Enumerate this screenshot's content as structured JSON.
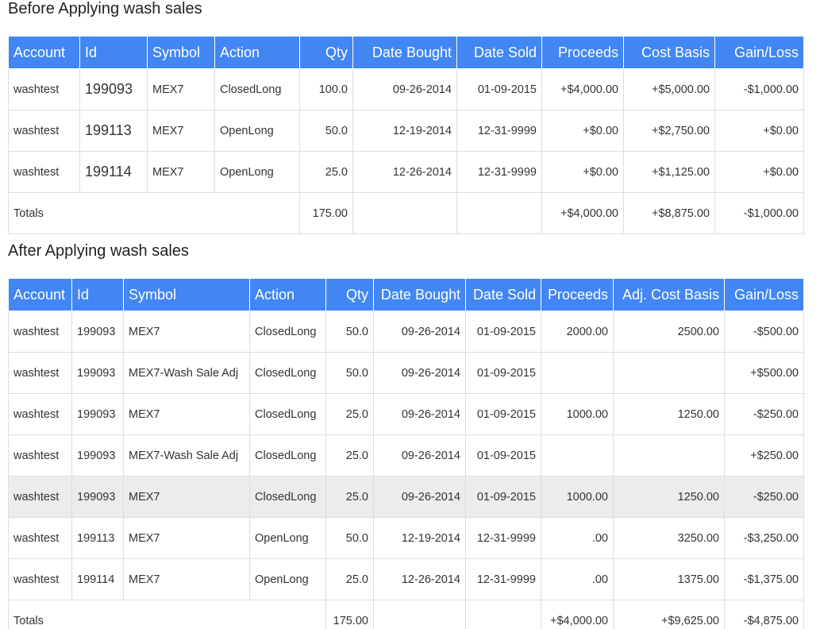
{
  "before": {
    "title": "Before Applying wash sales",
    "headers": {
      "account": "Account",
      "id": "Id",
      "symbol": "Symbol",
      "action": "Action",
      "qty": "Qty",
      "date_bought": "Date Bought",
      "date_sold": "Date Sold",
      "proceeds": "Proceeds",
      "cost_basis": "Cost Basis",
      "gain_loss": "Gain/Loss"
    },
    "rows": [
      {
        "account": "washtest",
        "id": "199093",
        "symbol": "MEX7",
        "action": "ClosedLong",
        "qty": "100.0",
        "date_bought": "09-26-2014",
        "date_sold": "01-09-2015",
        "proceeds": "+$4,000.00",
        "cost_basis": "+$5,000.00",
        "gain_loss": "-$1,000.00"
      },
      {
        "account": "washtest",
        "id": "199113",
        "symbol": "MEX7",
        "action": "OpenLong",
        "qty": "50.0",
        "date_bought": "12-19-2014",
        "date_sold": "12-31-9999",
        "proceeds": "+$0.00",
        "cost_basis": "+$2,750.00",
        "gain_loss": "+$0.00"
      },
      {
        "account": "washtest",
        "id": "199114",
        "symbol": "MEX7",
        "action": "OpenLong",
        "qty": "25.0",
        "date_bought": "12-26-2014",
        "date_sold": "12-31-9999",
        "proceeds": "+$0.00",
        "cost_basis": "+$1,125.00",
        "gain_loss": "+$0.00"
      }
    ],
    "totals": {
      "label": "Totals",
      "qty": "175.00",
      "proceeds": "+$4,000.00",
      "cost_basis": "+$8,875.00",
      "gain_loss": "-$1,000.00"
    }
  },
  "after": {
    "title": "After Applying wash sales",
    "headers": {
      "account": "Account",
      "id": "Id",
      "symbol": "Symbol",
      "action": "Action",
      "qty": "Qty",
      "date_bought": "Date Bought",
      "date_sold": "Date Sold",
      "proceeds": "Proceeds",
      "cost_basis": "Adj. Cost Basis",
      "gain_loss": "Gain/Loss"
    },
    "rows": [
      {
        "account": "washtest",
        "id": "199093",
        "symbol": "MEX7",
        "action": "ClosedLong",
        "qty": "50.0",
        "date_bought": "09-26-2014",
        "date_sold": "01-09-2015",
        "proceeds": "2000.00",
        "cost_basis": "2500.00",
        "gain_loss": "-$500.00"
      },
      {
        "account": "washtest",
        "id": "199093",
        "symbol": "MEX7-Wash Sale Adj",
        "action": "ClosedLong",
        "qty": "50.0",
        "date_bought": "09-26-2014",
        "date_sold": "01-09-2015",
        "proceeds": "",
        "cost_basis": "",
        "gain_loss": "+$500.00"
      },
      {
        "account": "washtest",
        "id": "199093",
        "symbol": "MEX7",
        "action": "ClosedLong",
        "qty": "25.0",
        "date_bought": "09-26-2014",
        "date_sold": "01-09-2015",
        "proceeds": "1000.00",
        "cost_basis": "1250.00",
        "gain_loss": "-$250.00"
      },
      {
        "account": "washtest",
        "id": "199093",
        "symbol": "MEX7-Wash Sale Adj",
        "action": "ClosedLong",
        "qty": "25.0",
        "date_bought": "09-26-2014",
        "date_sold": "01-09-2015",
        "proceeds": "",
        "cost_basis": "",
        "gain_loss": "+$250.00"
      },
      {
        "account": "washtest",
        "id": "199093",
        "symbol": "MEX7",
        "action": "ClosedLong",
        "qty": "25.0",
        "date_bought": "09-26-2014",
        "date_sold": "01-09-2015",
        "proceeds": "1000.00",
        "cost_basis": "1250.00",
        "gain_loss": "-$250.00"
      },
      {
        "account": "washtest",
        "id": "199113",
        "symbol": "MEX7",
        "action": "OpenLong",
        "qty": "50.0",
        "date_bought": "12-19-2014",
        "date_sold": "12-31-9999",
        "proceeds": ".00",
        "cost_basis": "3250.00",
        "gain_loss": "-$3,250.00"
      },
      {
        "account": "washtest",
        "id": "199114",
        "symbol": "MEX7",
        "action": "OpenLong",
        "qty": "25.0",
        "date_bought": "12-26-2014",
        "date_sold": "12-31-9999",
        "proceeds": ".00",
        "cost_basis": "1375.00",
        "gain_loss": "-$1,375.00"
      }
    ],
    "totals": {
      "label": "Totals",
      "qty": "175.00",
      "proceeds": "+$4,000.00",
      "cost_basis": "+$9,625.00",
      "gain_loss": "-$4,875.00"
    }
  },
  "colors": {
    "header_bg": "#4286f4",
    "negative": "#e8333a",
    "positive": "#1fad4b",
    "highlight_row": "#ececec"
  }
}
